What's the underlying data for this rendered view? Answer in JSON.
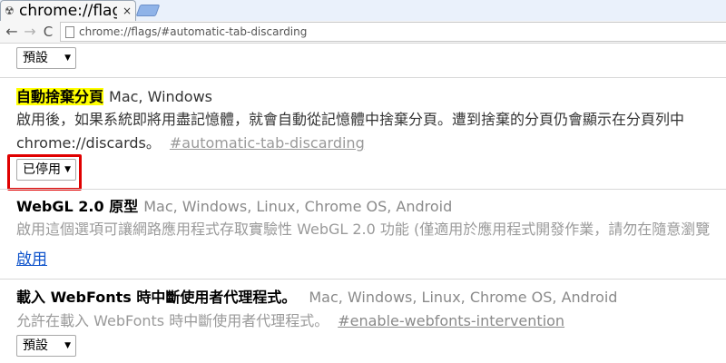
{
  "tab": {
    "title": "chrome://flags",
    "close": "×"
  },
  "toolbar": {
    "back": "←",
    "forward": "→",
    "reload": "C",
    "url": "chrome://flags/#automatic-tab-discarding"
  },
  "flags": [
    {
      "select_value": "預設"
    },
    {
      "name": "自動捨棄分頁",
      "platforms": "Mac, Windows",
      "description": "啟用後，如果系統即將用盡記憶體，就會自動從記憶體中捨棄分頁。遭到捨棄的分頁仍會顯示在分頁列中",
      "description_cont": "chrome://discards。",
      "anchor": "#automatic-tab-discarding",
      "select_value": "已停用"
    },
    {
      "name": "WebGL 2.0 原型",
      "platforms": "Mac, Windows, Linux, Chrome OS, Android",
      "description": "啟用這個選項可讓網路應用程式存取實驗性 WebGL 2.0 功能 (僅適用於應用程式開發作業，請勿在隨意瀏覽",
      "link": "啟用"
    },
    {
      "name": "載入 WebFonts 時中斷使用者代理程式。",
      "platforms": "Mac, Windows, Linux, Chrome OS, Android",
      "description": "允許在載入 WebFonts 時中斷使用者代理程式。",
      "anchor": "#enable-webfonts-intervention",
      "select_value": "預設"
    }
  ],
  "colors": {
    "highlight": "#ffff00",
    "annotation_box": "#e00000",
    "link": "#1155cc"
  }
}
